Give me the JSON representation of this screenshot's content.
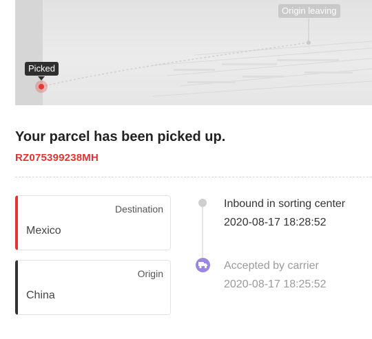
{
  "map": {
    "picked_tag": "Picked",
    "origin_tag": "Origin leaving"
  },
  "parcel": {
    "status_title": "Your parcel has been picked up.",
    "tracking_number": "RZ075399238MH"
  },
  "destination": {
    "label": "Destination",
    "country": "Mexico",
    "accent_color": "#e13333"
  },
  "origin": {
    "label": "Origin",
    "country": "China",
    "accent_color": "#333333"
  },
  "timeline": [
    {
      "status": "Inbound in sorting center",
      "time": "2020-08-17 18:28:52",
      "icon": "dot-icon"
    },
    {
      "status": "Accepted by carrier",
      "time": "2020-08-17 18:25:52",
      "icon": "truck-icon",
      "icon_color": "#9b86e0"
    }
  ]
}
